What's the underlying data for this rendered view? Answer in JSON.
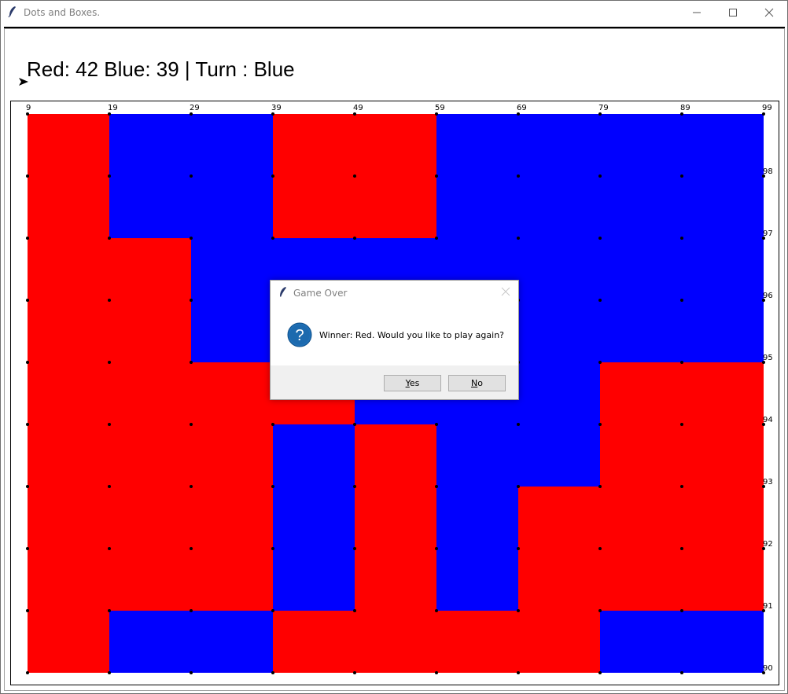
{
  "window": {
    "title": "Dots and Boxes."
  },
  "status": {
    "text": "Red: 42 Blue: 39 | Turn : Blue",
    "red_score": 42,
    "blue_score": 39,
    "turn": "Blue"
  },
  "board": {
    "rows": 9,
    "cols": 9,
    "colors": {
      "R": "#ff0000",
      "B": "#0000ff"
    },
    "top_labels": [
      "9",
      "19",
      "29",
      "39",
      "49",
      "59",
      "69",
      "79",
      "89",
      "99"
    ],
    "right_labels": [
      "98",
      "97",
      "96",
      "95",
      "94",
      "93",
      "92",
      "91",
      "90"
    ],
    "cells": [
      [
        "R",
        "B",
        "B",
        "R",
        "R",
        "B",
        "B",
        "B",
        "B"
      ],
      [
        "R",
        "B",
        "B",
        "R",
        "R",
        "B",
        "B",
        "B",
        "B"
      ],
      [
        "R",
        "R",
        "B",
        "B",
        "B",
        "B",
        "B",
        "B",
        "B"
      ],
      [
        "R",
        "R",
        "B",
        "B",
        "B",
        "B",
        "B",
        "B",
        "B"
      ],
      [
        "R",
        "R",
        "R",
        "R",
        "B",
        "B",
        "B",
        "R",
        "R"
      ],
      [
        "R",
        "R",
        "R",
        "B",
        "R",
        "B",
        "B",
        "R",
        "R"
      ],
      [
        "R",
        "R",
        "R",
        "B",
        "R",
        "B",
        "R",
        "R",
        "R"
      ],
      [
        "R",
        "R",
        "R",
        "B",
        "R",
        "B",
        "R",
        "R",
        "R"
      ],
      [
        "R",
        "B",
        "B",
        "R",
        "R",
        "R",
        "R",
        "B",
        "B"
      ]
    ]
  },
  "dialog": {
    "title": "Game Over",
    "message": "Winner: Red. Would you like to play again?",
    "yes_prefix": "",
    "yes_u": "Y",
    "yes_rest": "es",
    "no_prefix": "",
    "no_u": "N",
    "no_rest": "o",
    "icon": "question-icon"
  }
}
